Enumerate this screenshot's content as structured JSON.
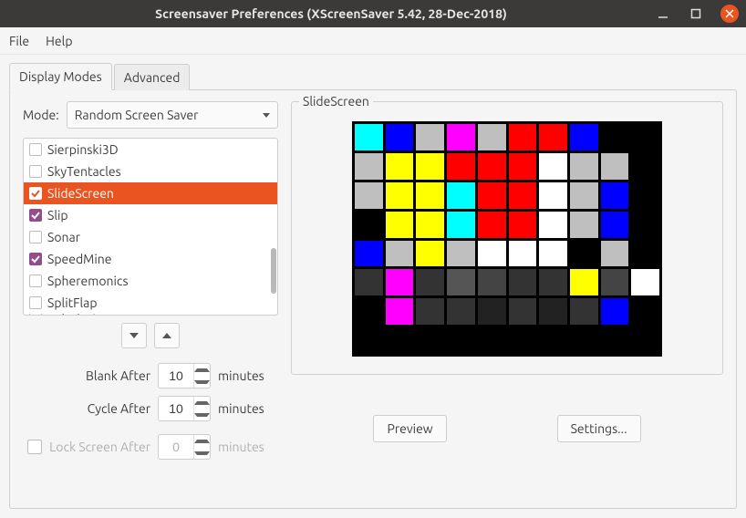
{
  "title": "Screensaver Preferences  (XScreenSaver 5.42, 28-Dec-2018)",
  "menu": {
    "file": "File",
    "help": "Help"
  },
  "tabs": {
    "display": "Display Modes",
    "advanced": "Advanced"
  },
  "mode": {
    "label": "Mode:",
    "value": "Random Screen Saver"
  },
  "list": [
    {
      "label": "Sierpinski3D",
      "checked": false,
      "selected": false
    },
    {
      "label": "SkyTentacles",
      "checked": false,
      "selected": false
    },
    {
      "label": "SlideScreen",
      "checked": true,
      "selected": true
    },
    {
      "label": "Slip",
      "checked": true,
      "selected": false
    },
    {
      "label": "Sonar",
      "checked": false,
      "selected": false
    },
    {
      "label": "SpeedMine",
      "checked": true,
      "selected": false
    },
    {
      "label": "Spheremonics",
      "checked": false,
      "selected": false
    },
    {
      "label": "SplitFlap",
      "checked": false,
      "selected": false
    },
    {
      "label": "Splodesic",
      "checked": false,
      "selected": false
    }
  ],
  "timing": {
    "blank_label": "Blank After",
    "blank_value": "10",
    "blank_unit": "minutes",
    "cycle_label": "Cycle After",
    "cycle_value": "10",
    "cycle_unit": "minutes",
    "lock_label": "Lock Screen After",
    "lock_value": "0",
    "lock_unit": "minutes"
  },
  "preview": {
    "legend": "SlideScreen",
    "preview_btn": "Preview",
    "settings_btn": "Settings...",
    "tiles": [
      "#00ffff",
      "#0000ff",
      "#bfbfbf",
      "#ff00ff",
      "#bfbfbf",
      "#ff0000",
      "#ff0000",
      "#0000ff",
      "#000000",
      "#000000",
      "#bfbfbf",
      "#ffff00",
      "#ffff00",
      "#ff0000",
      "#ff0000",
      "#ff0000",
      "#ffffff",
      "#bfbfbf",
      "#bfbfbf",
      "#000000",
      "#bfbfbf",
      "#ffff00",
      "#ffff00",
      "#00ffff",
      "#ff0000",
      "#ff0000",
      "#ffffff",
      "#bfbfbf",
      "#0000ff",
      "#000000",
      "#000000",
      "#ffff00",
      "#ffff00",
      "#00ffff",
      "#ff0000",
      "#ff0000",
      "#ffffff",
      "#bfbfbf",
      "#0000ff",
      "#000000",
      "#0000ff",
      "#bfbfbf",
      "#ffff00",
      "#bfbfbf",
      "#ffffff",
      "#ffffff",
      "#ffffff",
      "#000000",
      "#bfbfbf",
      "#000000",
      "#333333",
      "#ff00ff",
      "#333333",
      "#555555",
      "#444444",
      "#333333",
      "#333333",
      "#ffff00",
      "#444444",
      "#ffffff",
      "#000000",
      "#ff00ff",
      "#333333",
      "#333333",
      "#222222",
      "#333333",
      "#222222",
      "#333333",
      "#0000ff",
      "#000000",
      "#000000",
      "#000000",
      "#000000",
      "#000000",
      "#000000",
      "#000000",
      "#000000",
      "#000000",
      "#000000",
      "#000000"
    ]
  }
}
